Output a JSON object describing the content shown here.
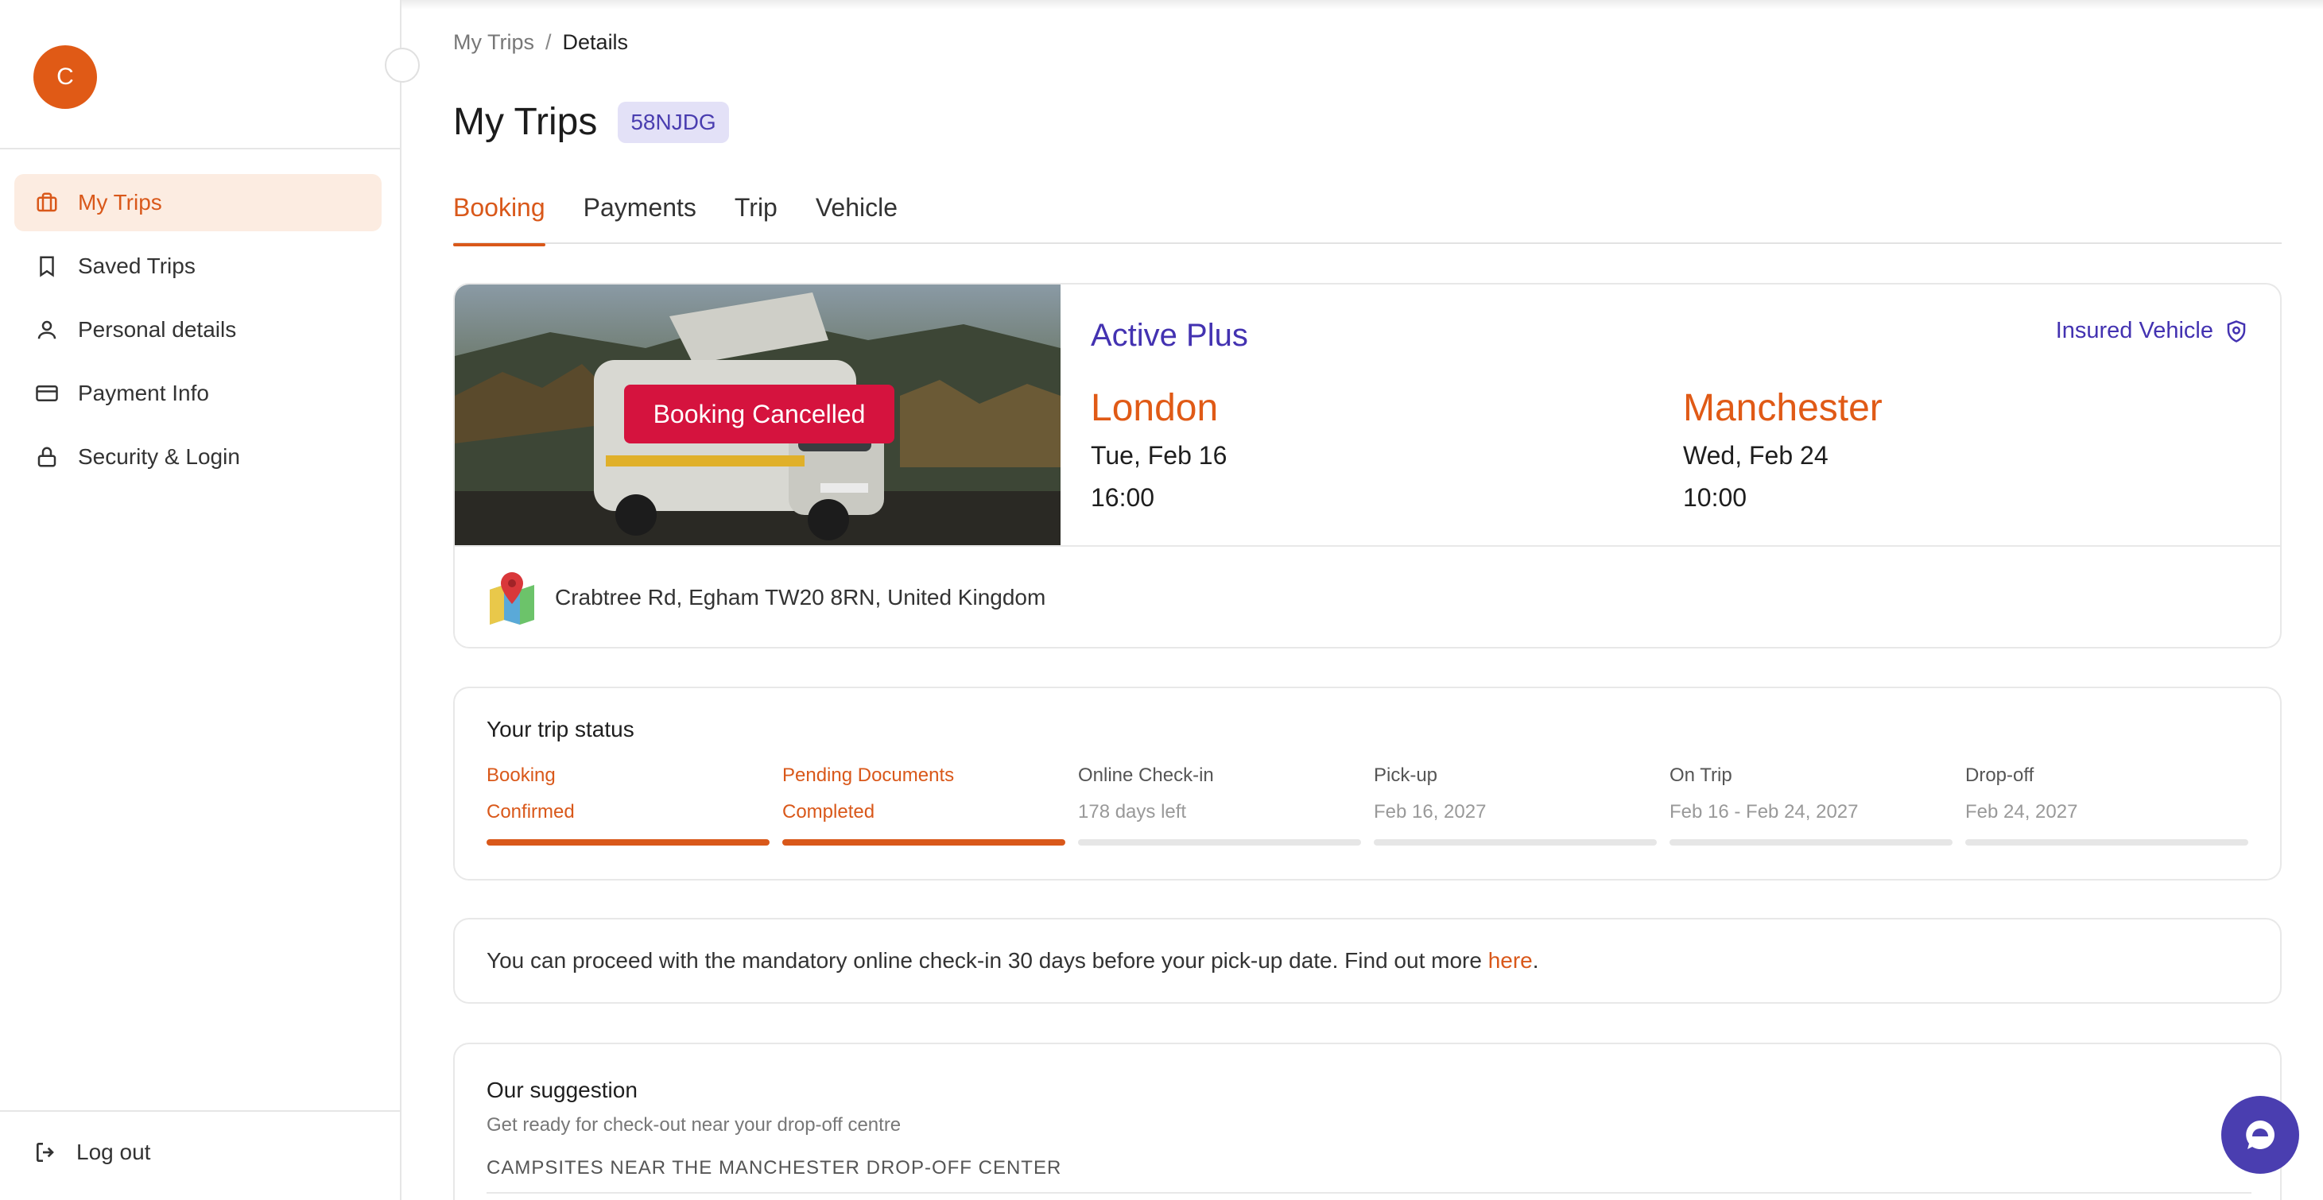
{
  "user": {
    "avatar_initial": "C"
  },
  "sidebar": {
    "items": [
      {
        "label": "My Trips",
        "icon": "briefcase-icon",
        "active": true
      },
      {
        "label": "Saved Trips",
        "icon": "bookmark-icon",
        "active": false
      },
      {
        "label": "Personal details",
        "icon": "user-icon",
        "active": false
      },
      {
        "label": "Payment Info",
        "icon": "credit-card-icon",
        "active": false
      },
      {
        "label": "Security & Login",
        "icon": "lock-icon",
        "active": false
      }
    ],
    "logout_label": "Log out"
  },
  "breadcrumb": {
    "parent": "My Trips",
    "separator": "/",
    "current": "Details"
  },
  "page": {
    "title": "My Trips",
    "booking_ref": "58NJDG"
  },
  "tabs": [
    {
      "label": "Booking",
      "active": true
    },
    {
      "label": "Payments",
      "active": false
    },
    {
      "label": "Trip",
      "active": false
    },
    {
      "label": "Vehicle",
      "active": false
    }
  ],
  "booking": {
    "status_badge": "Booking Cancelled",
    "plan": "Active Plus",
    "insured_label": "Insured Vehicle",
    "pickup": {
      "city": "London",
      "date": "Tue, Feb 16",
      "time": "16:00"
    },
    "dropoff": {
      "city": "Manchester",
      "date": "Wed, Feb 24",
      "time": "10:00"
    },
    "address": "Crabtree Rd, Egham TW20 8RN, United Kingdom"
  },
  "trip_status": {
    "title": "Your trip status",
    "steps": [
      {
        "label": "Booking",
        "sub": "Confirmed",
        "done": true
      },
      {
        "label": "Pending Documents",
        "sub": "Completed",
        "done": true
      },
      {
        "label": "Online Check-in",
        "sub": "178 days left",
        "done": false
      },
      {
        "label": "Pick-up",
        "sub": "Feb 16, 2027",
        "done": false
      },
      {
        "label": "On Trip",
        "sub": "Feb 16 - Feb 24, 2027",
        "done": false
      },
      {
        "label": "Drop-off",
        "sub": "Feb 24, 2027",
        "done": false
      }
    ]
  },
  "notice": {
    "text": "You can proceed with the mandatory online check-in 30 days before your pick-up date. Find out more ",
    "link_label": "here",
    "end": "."
  },
  "suggestion": {
    "title": "Our suggestion",
    "subtitle": "Get ready for check-out near your drop-off centre",
    "heading": "CAMPSITES NEAR THE MANCHESTER DROP-OFF CENTER"
  },
  "colors": {
    "accent": "#d9581a",
    "brand": "#4332b1",
    "cancel": "#d5133e"
  }
}
